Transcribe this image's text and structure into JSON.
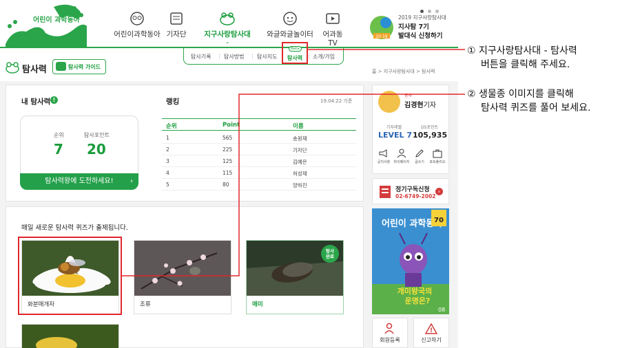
{
  "header": {
    "logo_text": "어린이 과학동아",
    "nav": [
      {
        "label": "어린이과학동아",
        "icon": "owl-icon",
        "active": false
      },
      {
        "label": "기자단",
        "icon": "notepad-icon",
        "active": false
      },
      {
        "label": "지구사랑탐사대",
        "icon": "frog-icon",
        "active": true
      },
      {
        "label": "와글와글놀이터",
        "icon": "playground-icon",
        "active": false
      },
      {
        "label": "어과동TV",
        "icon": "tv-icon",
        "active": false
      }
    ],
    "promo": {
      "year_line": "2019 지구사랑탐사대",
      "line1": "지사탐 7기",
      "line2": "발대식 신청하기",
      "badge": "20 19"
    }
  },
  "subnav": {
    "items": [
      "탐사기록",
      "탐사방법",
      "탐사지도",
      "탐사력",
      "소개/가입"
    ],
    "beta": "Beta",
    "active": "탐사력"
  },
  "page": {
    "title": "탐사력",
    "guide_button": "탐사력 가이드",
    "breadcrumb": "홈 > 지구사랑탐사대 > 탐사력"
  },
  "my_power": {
    "title": "내 탐사력",
    "info_mark": "!",
    "rank_label": "순위",
    "rank_value": "7",
    "points_label": "탐사포인트",
    "points_value": "20",
    "challenge_button": "탐사력왕에 도전하세요!"
  },
  "ranking": {
    "title": "랭킹",
    "date": "19.04.22 기준",
    "columns": [
      "순위",
      "Point",
      "이름"
    ],
    "rows": [
      {
        "rank": "1",
        "point": "565",
        "name": "송원재"
      },
      {
        "rank": "2",
        "point": "225",
        "name": "기자단"
      },
      {
        "rank": "3",
        "point": "125",
        "name": "김예은"
      },
      {
        "rank": "4",
        "point": "115",
        "name": "허성재"
      },
      {
        "rank": "5",
        "point": "80",
        "name": "양하진"
      }
    ]
  },
  "quiz": {
    "title": "매일 새로운 탐사력 퀴즈가 출제됩니다.",
    "cards": [
      {
        "label": "화분매개자",
        "done": false
      },
      {
        "label": "조류",
        "done": false
      },
      {
        "label": "매미",
        "done": true,
        "badge_line1": "탐사",
        "badge_line2": "완료"
      }
    ]
  },
  "profile": {
    "role": "동아",
    "name": "김경현",
    "name_suffix": "기자",
    "level_label": "기자레벨",
    "points_label": "DS포인트",
    "level": "LEVEL 7",
    "points": "105,935",
    "icons": [
      {
        "label": "공지사항",
        "icon": "megaphone-icon"
      },
      {
        "label": "마이페이지",
        "icon": "person-icon"
      },
      {
        "label": "글쓰기",
        "icon": "pencil-icon"
      },
      {
        "label": "포트폴리오",
        "icon": "briefcase-icon"
      }
    ]
  },
  "subscribe": {
    "title": "정기구독신청",
    "phone": "02-6749-2002"
  },
  "magazine": {
    "logo": "어린이 과학동아",
    "cover_line1": "개미왕국의",
    "cover_line2": "운명은?",
    "issue": "08",
    "price_tag": "70"
  },
  "bottom_buttons": [
    "회원등록",
    "신고하기"
  ],
  "annotations": {
    "step1_line1": "① 지구사랑탐사대  -  탐사력",
    "step1_line2": "버튼을 클릭해 주세요.",
    "step2_line1": "② 생물종 이미지를 클릭해",
    "step2_line2": "탐사력 퀴즈를 풀어 보세요."
  },
  "colors": {
    "accent": "#2aa54a",
    "highlight": "#e0262b"
  }
}
